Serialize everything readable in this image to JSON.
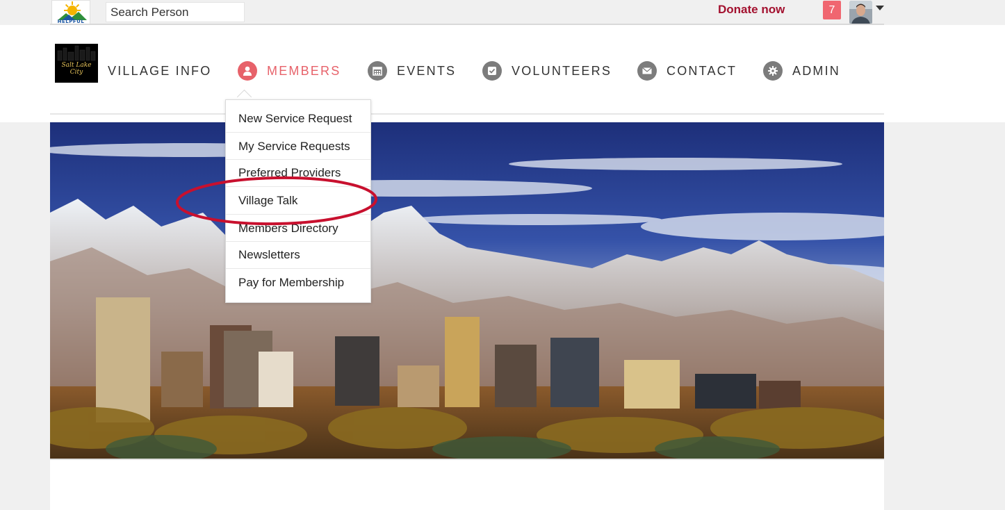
{
  "topbar": {
    "logo_text": "HELPFUL",
    "search_placeholder": "Search Person",
    "donate_label": "Donate now",
    "notification_count": "7"
  },
  "nav": {
    "logo_text": "Salt Lake City",
    "items": [
      {
        "label": "VILLAGE INFO",
        "icon": "village-info"
      },
      {
        "label": "MEMBERS",
        "icon": "user-icon",
        "active": true
      },
      {
        "label": "EVENTS",
        "icon": "calendar-icon"
      },
      {
        "label": "VOLUNTEERS",
        "icon": "check-icon"
      },
      {
        "label": "CONTACT",
        "icon": "envelope-icon"
      },
      {
        "label": "ADMIN",
        "icon": "gear-icon"
      }
    ]
  },
  "members_dropdown": {
    "items": [
      {
        "label": "New Service Request"
      },
      {
        "label": "My Service Requests"
      },
      {
        "label": "Preferred Providers"
      },
      {
        "label": "Village Talk",
        "annotated": true
      },
      {
        "label": "Members Directory"
      },
      {
        "label": "Newsletters"
      },
      {
        "label": "Pay for Membership"
      }
    ]
  },
  "colors": {
    "accent": "#e7626a",
    "donate": "#a3112f",
    "annotation": "#c8102e"
  }
}
